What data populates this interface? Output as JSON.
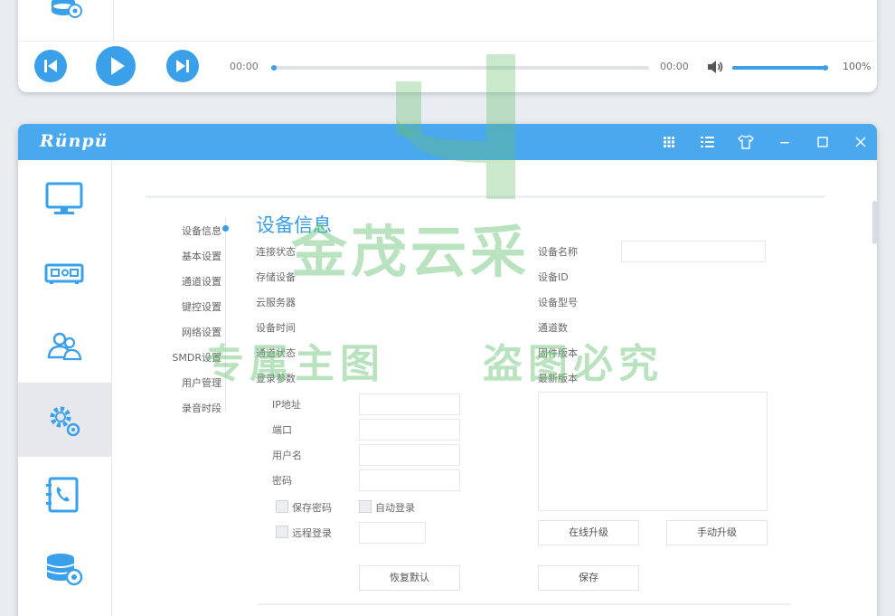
{
  "player": {
    "time_current": "00:00",
    "time_total": "00:00",
    "progress": 0.0,
    "volume_label": "100%",
    "volume": 1.0,
    "buttons": [
      "skip-previous-icon",
      "play-icon",
      "skip-next-icon"
    ]
  },
  "app": {
    "logo": "Rünpü",
    "titlebar_icons": [
      "grid-icon",
      "list-icon",
      "shirt-icon",
      "minimize-icon",
      "maximize-icon",
      "close-icon"
    ],
    "sidebar_items": [
      "monitor-icon",
      "device-icon",
      "users-icon",
      "settings-gear-icon",
      "phone-book-icon",
      "database-icon"
    ],
    "sidebar_active_index": 3,
    "accent_color": "#3aa0ea"
  },
  "nav": {
    "items": [
      "设备信息",
      "基本设置",
      "通道设置",
      "键控设置",
      "网络设置",
      "SMDR设置",
      "用户管理",
      "录音时段"
    ],
    "active_index": 0
  },
  "device_info": {
    "title": "设备信息",
    "left_labels": [
      "连接状态",
      "存储设备",
      "云服务器",
      "设备时间",
      "通道状态",
      "登录参数"
    ],
    "login": {
      "ip_label": "IP地址",
      "port_label": "端口",
      "username_label": "用户名",
      "password_label": "密码",
      "save_password_label": "保存密码",
      "auto_login_label": "自动登录",
      "remote_login_label": "远程登录",
      "restore_default_button": "恢复默认"
    },
    "right_labels": {
      "device_name": "设备名称",
      "device_id": "设备ID",
      "device_model": "设备型号",
      "channel_count": "通道数",
      "firmware_version": "固件版本",
      "latest_version": "最新版本"
    },
    "online_upgrade_button": "在线升级",
    "manual_upgrade_button": "手动升级",
    "save_button": "保存"
  },
  "watermark": {
    "main": "金茂云采",
    "sub1": "专属主图",
    "sub2": "盗图必究"
  }
}
